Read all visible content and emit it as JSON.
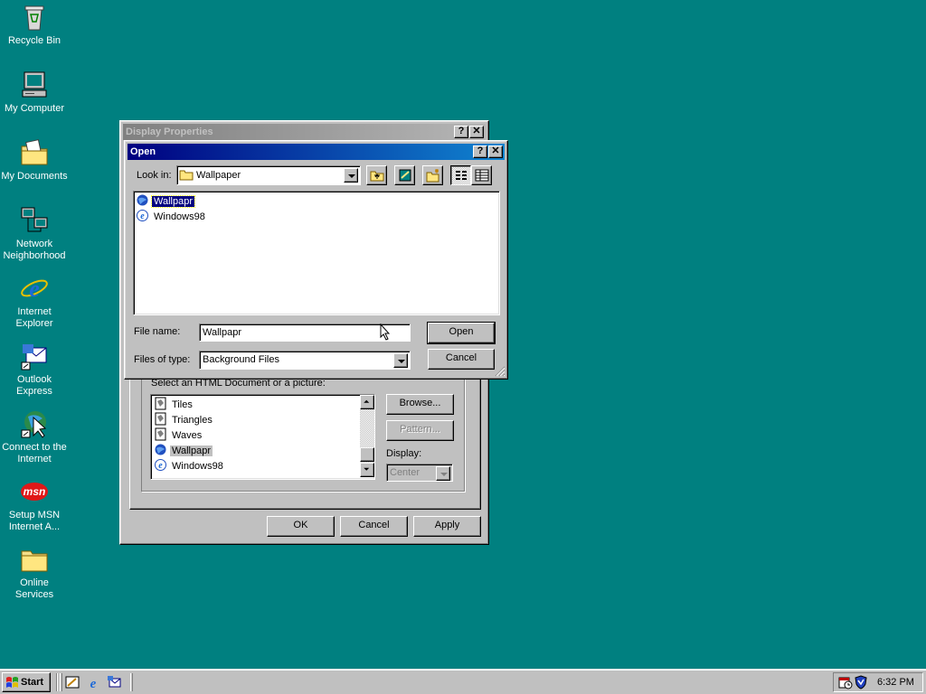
{
  "desktop": {
    "icons": [
      {
        "label": "Recycle Bin",
        "icon": "recycle-bin-icon"
      },
      {
        "label": "My Computer",
        "icon": "computer-icon"
      },
      {
        "label": "My Documents",
        "icon": "folder-documents-icon"
      },
      {
        "label": "Network Neighborhood",
        "icon": "network-icon"
      },
      {
        "label": "Internet Explorer",
        "icon": "internet-explorer-icon"
      },
      {
        "label": "Outlook Express",
        "icon": "outlook-express-icon"
      },
      {
        "label": "Connect to the Internet",
        "icon": "connect-internet-icon"
      },
      {
        "label": "Setup MSN Internet A...",
        "icon": "msn-icon"
      },
      {
        "label": "Online Services",
        "icon": "folder-icon"
      }
    ]
  },
  "display_properties": {
    "title": "Display Properties",
    "help_btn": "?",
    "close_btn": "✕",
    "select_label": "Select an HTML Document or a picture:",
    "wallpaper_list": [
      "Tiles",
      "Triangles",
      "Waves",
      "Wallpapr",
      "Windows98"
    ],
    "selected_wallpaper": "Wallpapr",
    "browse": "Browse...",
    "pattern": "Pattern...",
    "display_label": "Display:",
    "display_value": "Center",
    "ok": "OK",
    "cancel": "Cancel",
    "apply": "Apply"
  },
  "open_dialog": {
    "title": "Open",
    "help_btn": "?",
    "close_btn": "✕",
    "look_in_label": "Look in:",
    "look_in_value": "Wallpaper",
    "files": [
      {
        "name": "Wallpapr",
        "icon": "html-document-icon"
      },
      {
        "name": "Windows98",
        "icon": "html-document-icon"
      }
    ],
    "selected_file": "Wallpapr",
    "file_name_label": "File name:",
    "file_name_value": "Wallpapr",
    "files_of_type_label": "Files of type:",
    "files_of_type_value": "Background Files",
    "open": "Open",
    "cancel": "Cancel"
  },
  "taskbar": {
    "start": "Start",
    "clock": "6:32 PM"
  },
  "colors": {
    "desktop": "#008080",
    "title_active": "#000080",
    "title_inactive": "#808080",
    "face": "#c0c0c0"
  }
}
